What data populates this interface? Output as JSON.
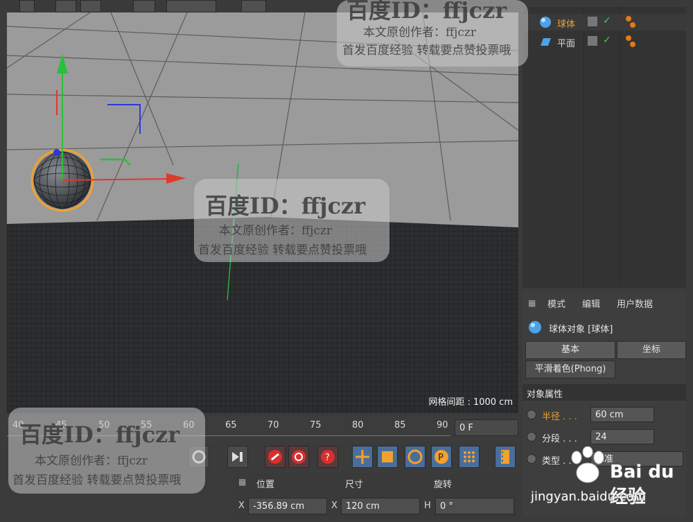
{
  "viewport": {
    "grid_spacing_label": "网格间距 : 1000 cm"
  },
  "object_manager": {
    "objects": [
      {
        "name": "球体",
        "icon": "sphere-icon",
        "color": "#f2a12f"
      },
      {
        "name": "平面",
        "icon": "plane-icon",
        "color": "#e0e0e0"
      }
    ]
  },
  "attribute_manager": {
    "menu": [
      "模式",
      "编辑",
      "用户数据"
    ],
    "object_title": "球体对象 [球体]",
    "tabs": [
      "基本",
      "坐标",
      "平滑着色(Phong)"
    ],
    "section_title": "对象属性",
    "properties": [
      {
        "label": "半径",
        "dots": " . . .",
        "value": "60 cm",
        "highlight": true
      },
      {
        "label": "分段",
        "dots": " . . .",
        "value": "24",
        "highlight": false
      },
      {
        "label": "类型",
        "dots": " . . .",
        "value": "标准",
        "highlight": false
      }
    ]
  },
  "timeline": {
    "ticks": [
      "40",
      "45",
      "50",
      "55",
      "60",
      "65",
      "70",
      "75",
      "80",
      "85",
      "90"
    ],
    "current_frame": "0 F"
  },
  "coordinates": {
    "headers": [
      "位置",
      "尺寸",
      "旋转"
    ],
    "position_x_label": "X",
    "position_x": "-356.89 cm",
    "size_x_label": "X",
    "size_x": "120 cm",
    "rotation_h_label": "H",
    "rotation_h": "0 °"
  },
  "watermarks": {
    "id_text": "百度ID：ffjczr",
    "author_text": "本文原创作者：ffjczr",
    "repost_text": "首发百度经验  转载要点赞投票哦",
    "logo_text": "Bai du 经验",
    "logo_url": "jingyan.baidu.com"
  },
  "colors": {
    "accent_orange": "#f2a12f",
    "axis_x": "#e03a2a",
    "axis_y": "#2bbf3a",
    "axis_z": "#2a3adf",
    "panel_bg": "#3b3b3b"
  }
}
